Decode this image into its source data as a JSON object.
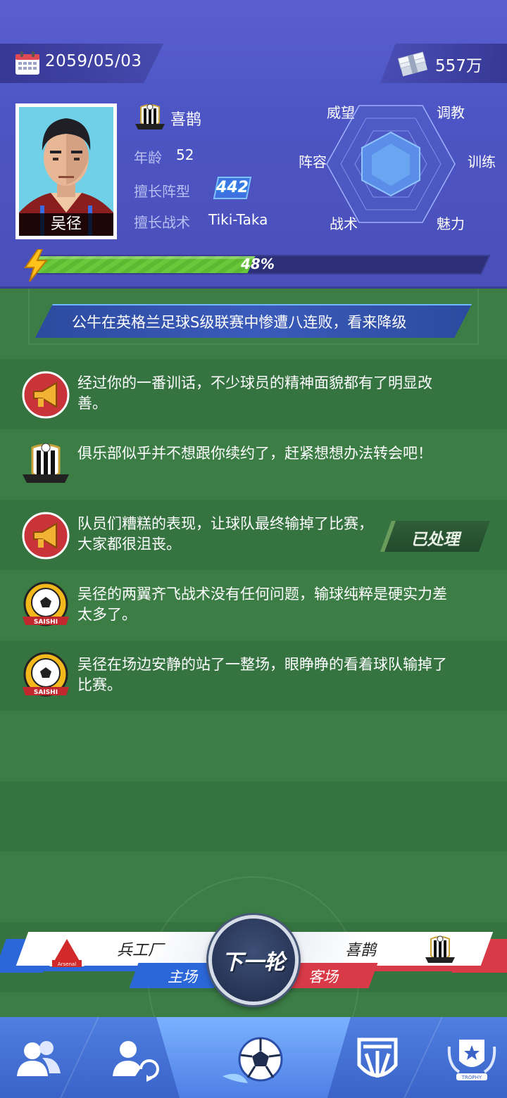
{
  "header": {
    "date": "2059/05/03",
    "money": "557万",
    "manager_name": "吴径",
    "team_name": "喜鹊",
    "age_label": "年龄",
    "age_value": "52",
    "formation_label": "擅长阵型",
    "formation_value": "442",
    "tactic_label": "擅长战术",
    "tactic_value": "Tiki-Taka",
    "energy_percent": 48,
    "energy_text": "48%"
  },
  "radar": {
    "top_left": "威望",
    "top_right": "调教",
    "left": "阵容",
    "right": "训练",
    "bottom_left": "战术",
    "bottom_right": "魅力"
  },
  "ticker": "公牛在英格兰足球S级联赛中惨遭八连败，看来降级",
  "messages": [
    {
      "icon": "megaphone-icon",
      "text": "经过你的一番训话，不少球员的精神面貌都有了明显改善。"
    },
    {
      "icon": "team-crest-icon",
      "text": "俱乐部似乎并不想跟你续约了，赶紧想想办法转会吧！"
    },
    {
      "icon": "megaphone-icon",
      "text": "队员们糟糕的表现，让球队最终输掉了比赛，大家都很沮丧。",
      "action": "已处理"
    },
    {
      "icon": "saishi-ball-icon",
      "text": "吴径的两翼齐飞战术没有任何问题，输球纯粹是硬实力差太多了。"
    },
    {
      "icon": "saishi-ball-icon",
      "text": "吴径在场边安静的站了一整场，眼睁睁的看着球队输掉了比赛。"
    }
  ],
  "match": {
    "home_team": "兵工厂",
    "home_label": "主场",
    "away_team": "喜鹊",
    "away_label": "客场",
    "next_button": "下一轮",
    "home_logo_text": "Arsenal",
    "saishi_text": "SAISHI",
    "trophy_text": "TROPHY"
  },
  "nav": [
    "team-icon",
    "transfer-icon",
    "match-ball-icon",
    "club-crest-icon",
    "trophy-icon"
  ],
  "colors": {
    "header": "#4d55c4",
    "pitch": "#3b7d45",
    "energy": "#69c93a",
    "home": "#2b67d8",
    "away": "#d93a48"
  }
}
